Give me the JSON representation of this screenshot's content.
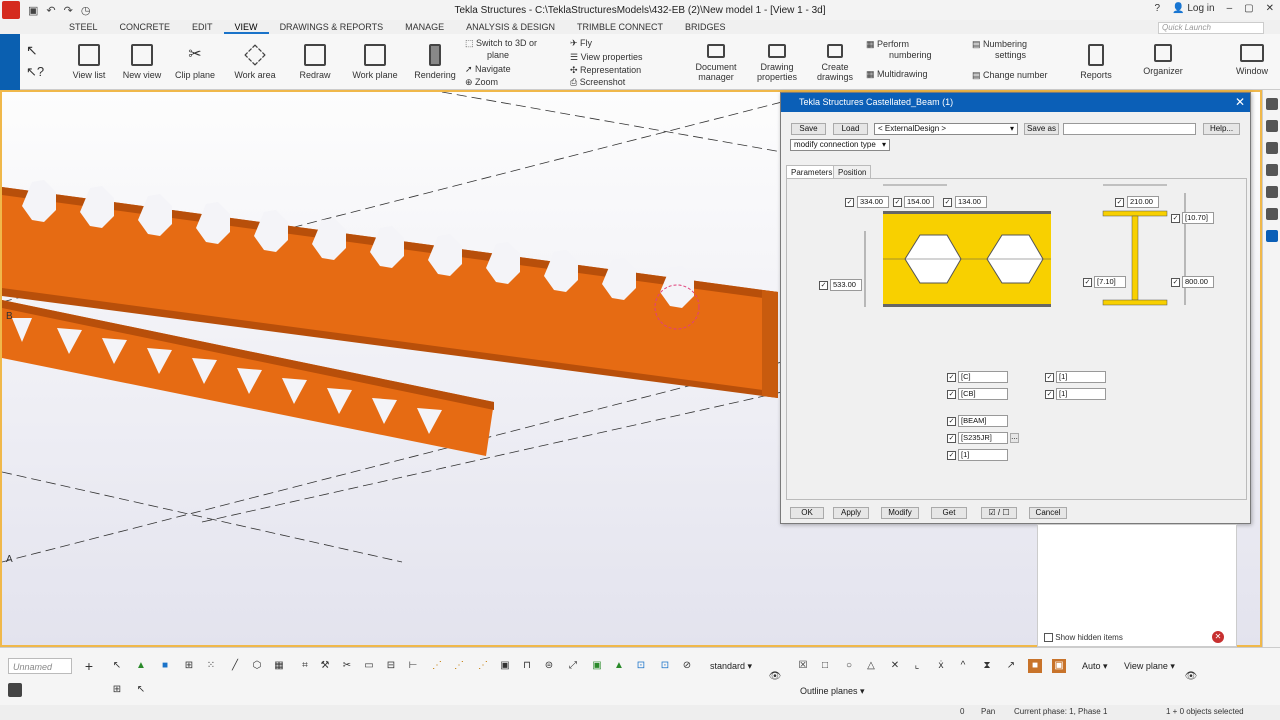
{
  "app": {
    "title": "Tekla Structures - C:\\TeklaStructuresModels\\432-EB (2)\\New model 1 - [View 1 - 3d]",
    "login": "Log in",
    "quick_launch": "Quick Launch"
  },
  "menu": [
    "STEEL",
    "CONCRETE",
    "EDIT",
    "VIEW",
    "DRAWINGS & REPORTS",
    "MANAGE",
    "ANALYSIS & DESIGN",
    "TRIMBLE CONNECT",
    "BRIDGES"
  ],
  "ribbon": {
    "view_list": "View list",
    "new_view": "New view",
    "clip_plane": "Clip plane",
    "work_area": "Work area",
    "redraw": "Redraw",
    "work_plane": "Work plane",
    "rendering": "Rendering",
    "switch_3d": "Switch to 3D or",
    "plane": "plane",
    "navigate": "Navigate",
    "zoom": "Zoom",
    "fly": "Fly",
    "view_properties": "View properties",
    "representation": "Representation",
    "screenshot": "Screenshot",
    "document_manager_1": "Document",
    "document_manager_2": "manager",
    "drawing_properties_1": "Drawing",
    "drawing_properties_2": "properties",
    "create_drawings_1": "Create",
    "create_drawings_2": "drawings",
    "perform_numbering_1": "Perform",
    "perform_numbering_2": "numbering",
    "multidrawing": "Multidrawing",
    "numbering_settings_1": "Numbering",
    "numbering_settings_2": "settings",
    "change_number": "Change number",
    "reports": "Reports",
    "organizer": "Organizer",
    "window": "Window"
  },
  "viewport": {
    "label_b": "B",
    "label_a": "A"
  },
  "dialog": {
    "title": "Tekla Structures  Castellated_Beam (1)",
    "save": "Save",
    "load": "Load",
    "design": "< ExternalDesign >",
    "save_as": "Save as",
    "help": "Help...",
    "connection_type": "modify connection type",
    "tab_parameters": "Parameters",
    "tab_position": "Position",
    "dims": {
      "d1": "334.00",
      "d2": "154.00",
      "d3": "134.00",
      "d4": "533.00",
      "d5": "210.00",
      "d6": "[10.70]",
      "d7": "[7.10]",
      "d8": "800.00"
    },
    "fields": {
      "prefix": "[C]",
      "prefix2": "[CB]",
      "num1": "[1]",
      "num2": "[1]",
      "name": "[BEAM]",
      "material": "[S235JR]",
      "finish": "[1]"
    },
    "ok": "OK",
    "apply": "Apply",
    "modify": "Modify",
    "get": "Get",
    "toggle": "☑ / ☐",
    "cancel": "Cancel",
    "ellipsis": "..."
  },
  "panel": {
    "show_hidden": "Show hidden items"
  },
  "bottom": {
    "unnamed": "Unnamed",
    "standard": "standard",
    "auto": "Auto",
    "view_plane": "View plane",
    "outline_planes": "Outline planes"
  },
  "status": {
    "zero": "0",
    "pan": "Pan",
    "phase": "Current phase: 1, Phase 1",
    "selected": "1 + 0 objects selected"
  },
  "colors": {
    "beam": "#e66b13",
    "beam_dark": "#b84f0a",
    "accent": "#0b5fb7",
    "yellow": "#f8d000"
  }
}
